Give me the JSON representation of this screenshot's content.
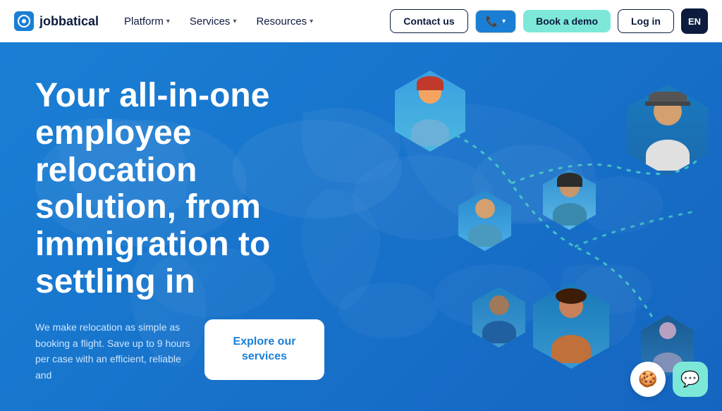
{
  "brand": {
    "name": "jobbatical",
    "logo_icon": "◆"
  },
  "navbar": {
    "links": [
      {
        "label": "Platform",
        "has_dropdown": true
      },
      {
        "label": "Services",
        "has_dropdown": true
      },
      {
        "label": "Resources",
        "has_dropdown": true
      }
    ],
    "contact_label": "Contact us",
    "book_demo_label": "Book a demo",
    "login_label": "Log in",
    "lang_label": "EN"
  },
  "hero": {
    "headline": "Your all-in-one employee relocation solution, from immigration to settling in",
    "description": "We make relocation as simple as booking a flight. Save up to 9 hours per case with an efficient, reliable and",
    "explore_label": "Explore our services"
  },
  "chat": {
    "icon": "💬",
    "cookie_icon": "🍪"
  }
}
